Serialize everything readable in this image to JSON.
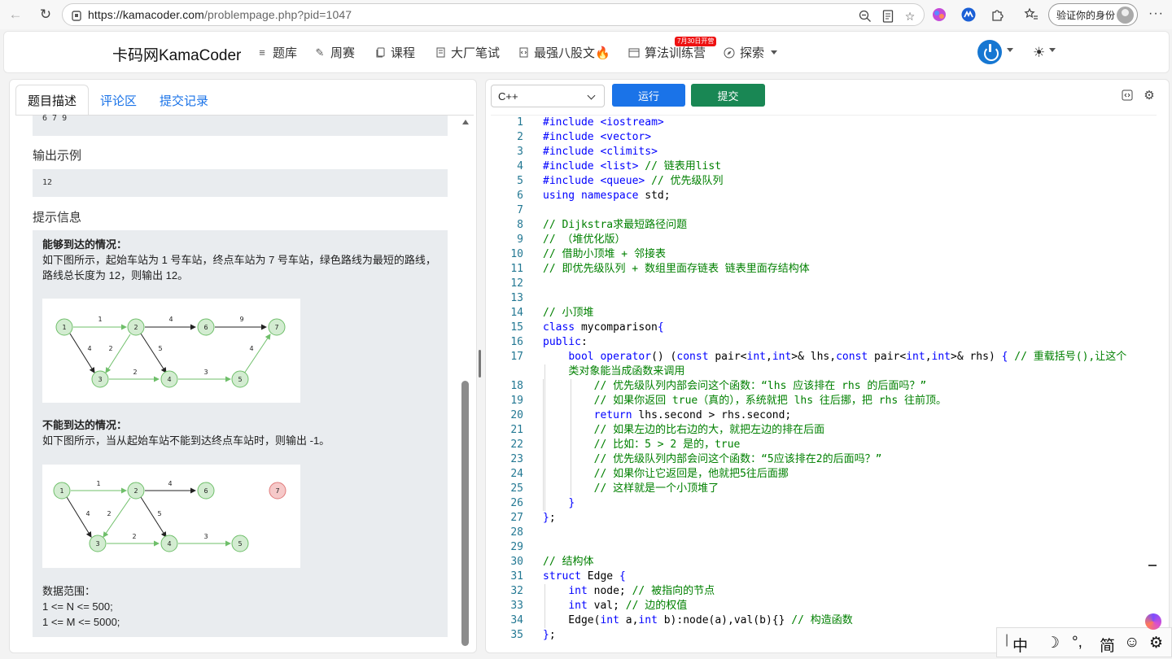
{
  "browser": {
    "url_host": "https://kamacoder.com",
    "url_path": "/problempage.php?pid=1047",
    "verify_label": "验证你的身份",
    "more_label": "···"
  },
  "header": {
    "logo": "卡码网KamaCoder",
    "nav": [
      {
        "label": "题库",
        "icon": "list-icon"
      },
      {
        "label": "周赛",
        "icon": "pencil-icon"
      },
      {
        "label": "课程",
        "icon": "copy-icon"
      },
      {
        "label": "大厂笔试",
        "icon": "doc-icon"
      },
      {
        "label": "最强八股文🔥",
        "icon": "file-code-icon"
      },
      {
        "label": "算法训练营",
        "icon": "calendar-icon"
      },
      {
        "label": "探索",
        "icon": "compass-icon"
      }
    ],
    "badge": "7月30日开营"
  },
  "left": {
    "tabs": [
      "题目描述",
      "评论区",
      "提交记录"
    ],
    "input_tail": "6 7 9",
    "output_title": "输出示例",
    "output_value": "12",
    "hint_title": "提示信息",
    "case1_title": "能够到达的情况：",
    "case1_text1": "如下图所示，起始车站为 1 号车站，终点车站为 7 号车站，绿色路线为最短的路线，",
    "case1_text2": "路线总长度为 12，则输出 12。",
    "case2_title": "不能到达的情况：",
    "case2_text": "如下图所示，当从起始车站不能到达终点车站时，则输出 -1。",
    "range_title": "数据范围：",
    "range1": "1 <= N <= 500;",
    "range2": "1 <= M <= 5000;",
    "graph_nodes": [
      "1",
      "2",
      "3",
      "4",
      "5",
      "6",
      "7"
    ],
    "graph_weights": [
      "1",
      "4",
      "9",
      "4",
      "2",
      "5",
      "2",
      "3",
      "4"
    ],
    "graph2_weights": [
      "1",
      "4",
      "4",
      "2",
      "5",
      "2",
      "3"
    ]
  },
  "editor": {
    "language": "C++",
    "run_label": "运行",
    "submit_label": "提交"
  },
  "ime": {
    "mode": "中",
    "moon": "☽",
    "punct": "°,",
    "simp": "简",
    "emoji": "☺",
    "gear": "⚙"
  }
}
